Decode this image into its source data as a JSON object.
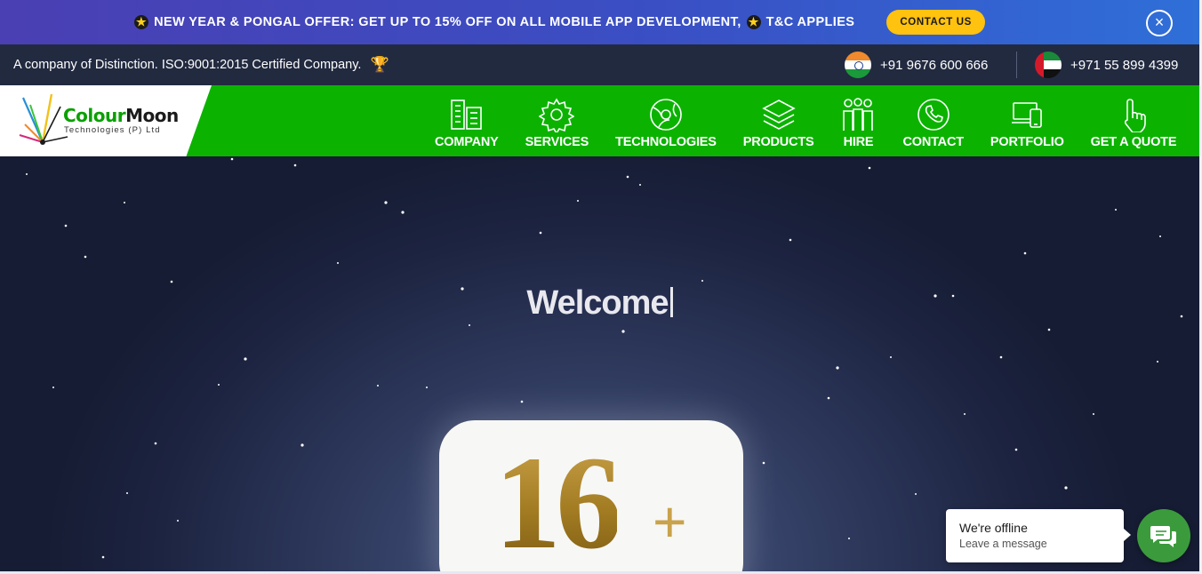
{
  "promo": {
    "text_part1": "NEW YEAR & PONGAL OFFER: GET UP TO 15% OFF ON ALL MOBILE APP DEVELOPMENT,",
    "text_part2": "T&C APPLIES",
    "star_icon": "star-icon",
    "cta_label": "CONTACT US",
    "close_icon": "×"
  },
  "infobar": {
    "tagline": "A company of Distinction. ISO:9001:2015 Certified Company.",
    "trophy_icon": "🏆",
    "phones": [
      {
        "flag": "india-flag-icon",
        "number": "+91 9676 600 666"
      },
      {
        "flag": "uae-flag-icon",
        "number": "+971 55 899 4399"
      }
    ]
  },
  "logo": {
    "word_colour": "Colour",
    "word_moon": "Moon",
    "subtitle": "Technologies (P) Ltd"
  },
  "nav": {
    "items": [
      {
        "label": "COMPANY",
        "icon": "building-icon"
      },
      {
        "label": "SERVICES",
        "icon": "gear-icon"
      },
      {
        "label": "TECHNOLOGIES",
        "icon": "globe-icon"
      },
      {
        "label": "PRODUCTS",
        "icon": "layers-icon"
      },
      {
        "label": "HIRE",
        "icon": "people-icon"
      },
      {
        "label": "CONTACT",
        "icon": "phone-icon"
      },
      {
        "label": "PORTFOLIO",
        "icon": "devices-icon"
      },
      {
        "label": "GET A QUOTE",
        "icon": "pointer-hand-icon"
      }
    ]
  },
  "hero": {
    "headline": "Welcome",
    "counter_value": "16",
    "counter_suffix": "+"
  },
  "chat": {
    "status": "We're offline",
    "subtitle": "Leave a message",
    "icon": "chat-icon"
  },
  "colors": {
    "nav_green": "#0bb300",
    "cta_yellow": "#ffc20e",
    "infobar_navy": "#222a40",
    "chat_green": "#3b9b3c"
  }
}
